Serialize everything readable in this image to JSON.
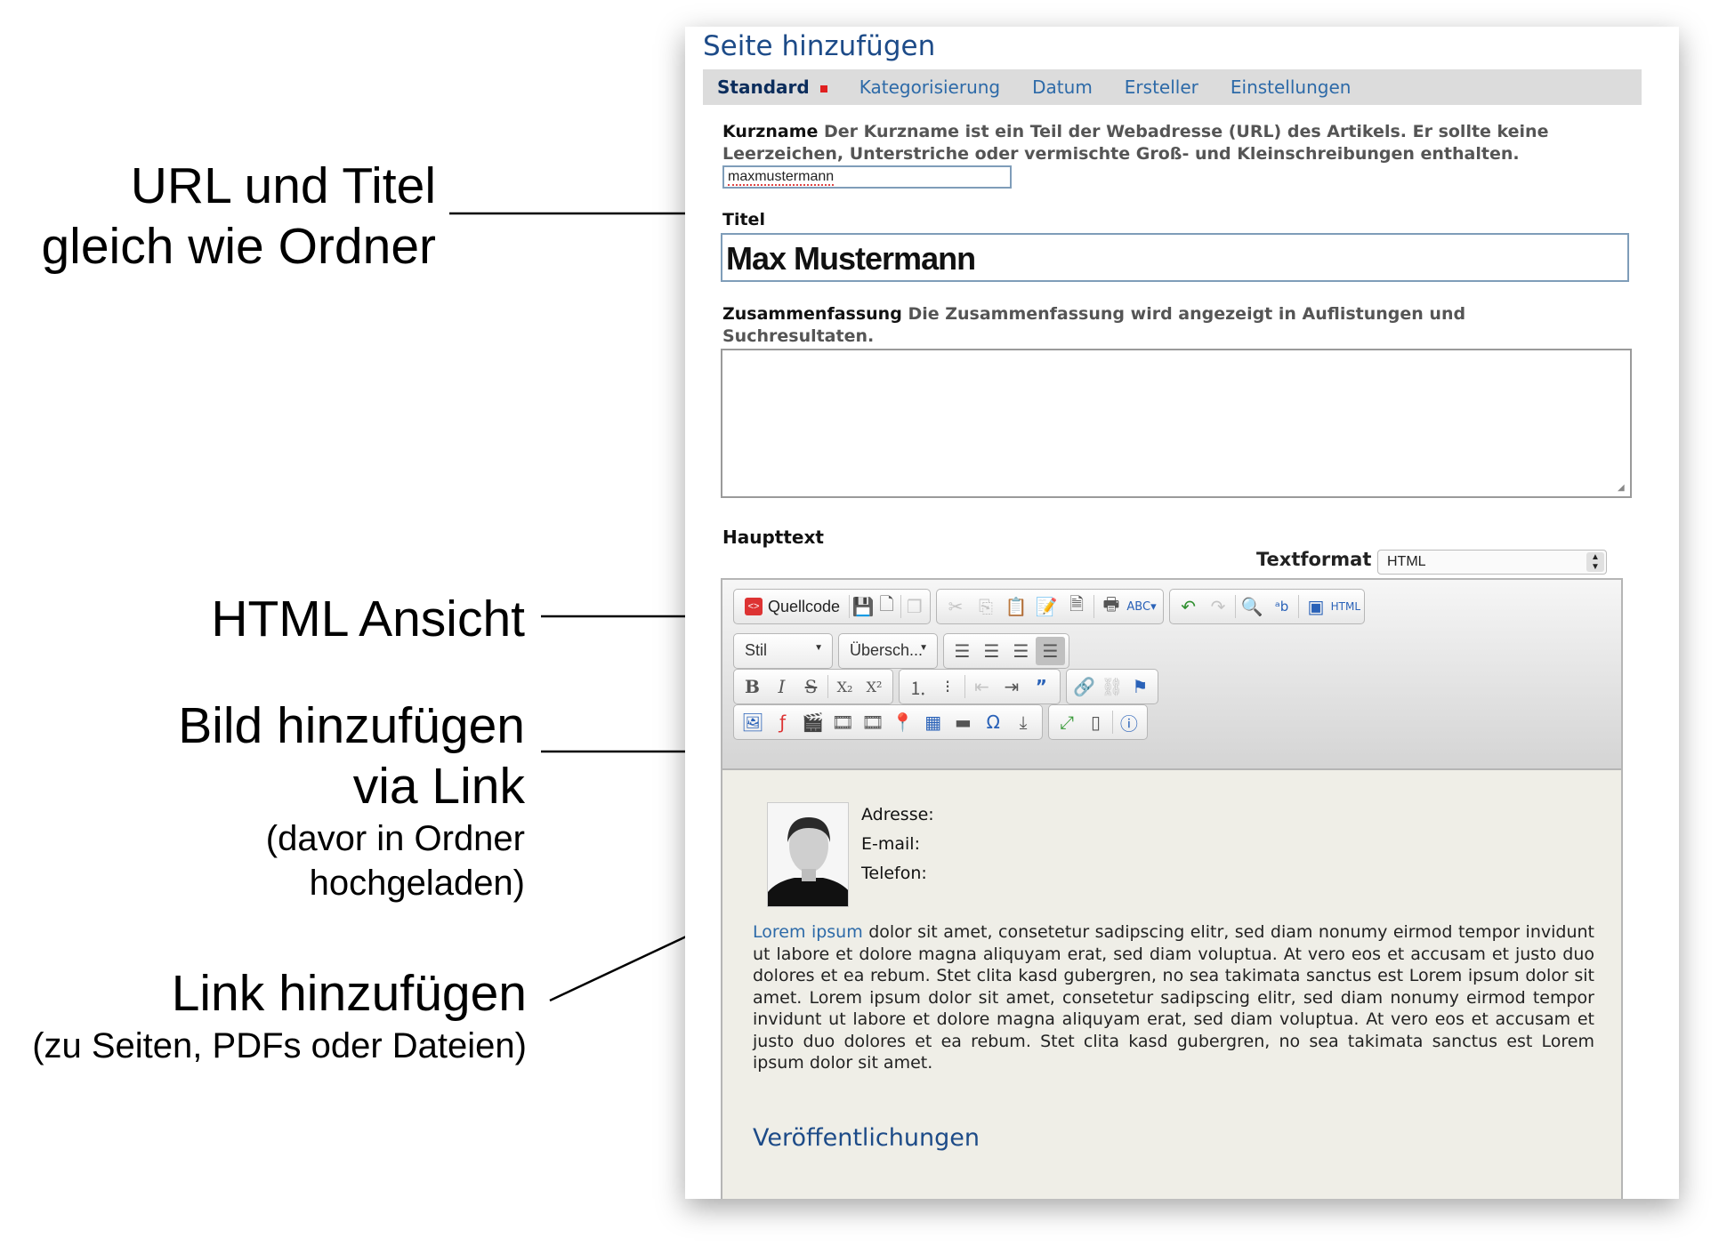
{
  "annotations": {
    "url_title": [
      "URL und Titel",
      "gleich wie Ordner"
    ],
    "html_view": "HTML Ansicht",
    "add_image": [
      "Bild hinzufügen",
      "via Link"
    ],
    "add_image_note": [
      "(davor in Ordner",
      "hochgeladen)"
    ],
    "add_link": "Link hinzufügen",
    "add_link_note": "(zu Seiten, PDFs oder Dateien)"
  },
  "page": {
    "title": "Seite hinzufügen",
    "tabs": [
      {
        "label": "Standard",
        "active": true
      },
      {
        "label": "Kategorisierung"
      },
      {
        "label": "Datum"
      },
      {
        "label": "Ersteller"
      },
      {
        "label": "Einstellungen"
      }
    ]
  },
  "form": {
    "shortname": {
      "label": "Kurzname",
      "help": "Der Kurzname ist ein Teil der Webadresse (URL) des Artikels. Er sollte keine Leerzeichen, Unterstriche oder vermischte Groß- und Kleinschreibungen enthalten.",
      "value": "maxmustermann"
    },
    "title": {
      "label": "Titel",
      "value": "Max Mustermann"
    },
    "summary": {
      "label": "Zusammenfassung",
      "help": "Die Zusammenfassung wird angezeigt in Auflistungen und Suchresultaten.",
      "value": ""
    },
    "body": {
      "label": "Haupttext",
      "textformat_label": "Textformat",
      "textformat_value": "HTML"
    }
  },
  "editor": {
    "source_button": "Quellcode",
    "style_combo": "Stil",
    "heading_combo": "Übersch...",
    "contact": {
      "address": "Adresse:",
      "email": "E-mail:",
      "phone": "Telefon:"
    },
    "paragraph_link": "Lorem ipsum",
    "paragraph": "dolor sit amet, consetetur sadipscing elitr, sed diam nonumy eirmod tempor invidunt ut labore et dolore magna aliquyam erat, sed diam voluptua. At vero eos et accusam et justo duo dolores et ea rebum. Stet clita kasd gubergren, no sea takimata sanctus est Lorem ipsum dolor sit amet. Lorem ipsum dolor sit amet, consetetur sadipscing elitr, sed diam nonumy eirmod tempor invidunt ut labore et dolore magna aliquyam erat, sed diam voluptua. At vero eos et accusam et justo duo dolores et ea rebum. Stet clita kasd gubergren, no sea takimata sanctus est Lorem ipsum dolor sit amet.",
    "section_heading": "Veröffentlichungen"
  },
  "colors": {
    "accent": "#1d4b88",
    "link": "#2d6aa8",
    "required": "#e02020",
    "editor_bg": "#efeee7"
  }
}
